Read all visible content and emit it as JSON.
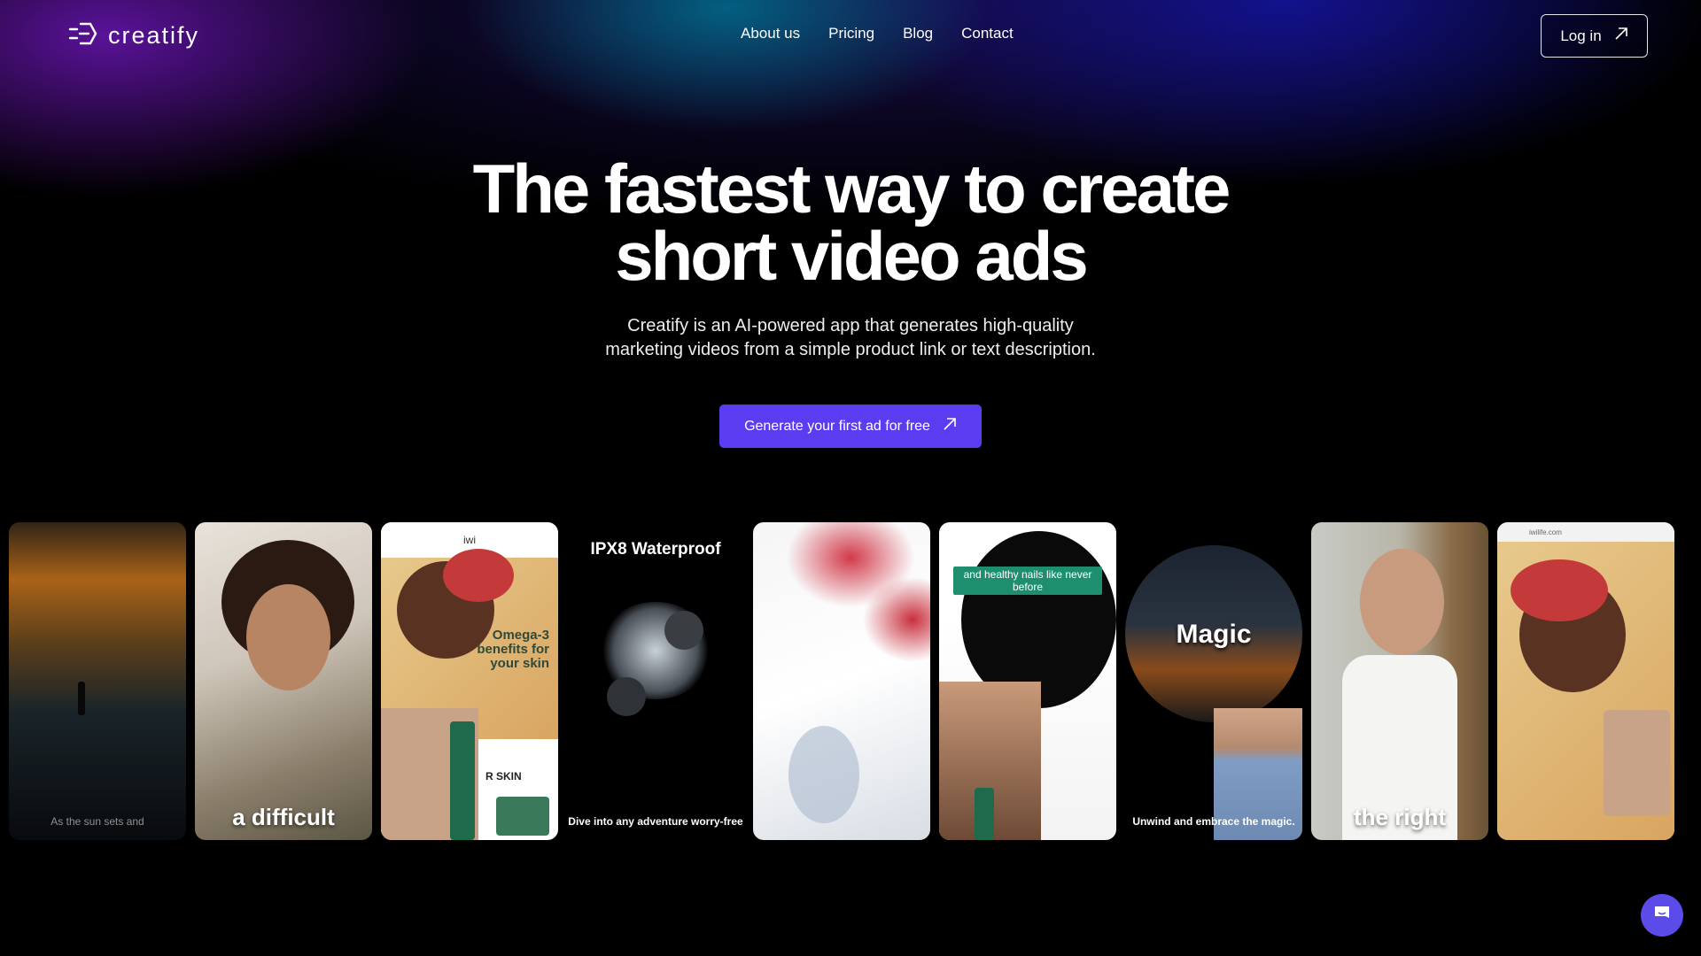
{
  "brand": {
    "name": "creatify"
  },
  "nav": {
    "items": [
      "About us",
      "Pricing",
      "Blog",
      "Contact"
    ],
    "login_label": "Log in"
  },
  "hero": {
    "title_line1": "The fastest way to create",
    "title_line2": "short video ads",
    "subtitle_line1": "Creatify is an AI-powered app that generates high-quality",
    "subtitle_line2": "marketing videos from a simple product link or text description.",
    "cta_label": "Generate your first ad for free"
  },
  "cards": [
    {
      "caption": "As the sun sets and"
    },
    {
      "caption": "a difficult"
    },
    {
      "brand": "iwi",
      "headline": "Omega-3 benefits for your skin",
      "badge": "R SKIN"
    },
    {
      "title": "IPX8 Waterproof",
      "caption": "Dive into any adventure worry-free"
    },
    {
      "caption": ""
    },
    {
      "banner": "and healthy nails like never before"
    },
    {
      "title": "Magic",
      "caption": "Unwind and embrace the magic."
    },
    {
      "caption": "the right"
    },
    {
      "url": "iwilife.com"
    }
  ],
  "colors": {
    "accent": "#5b3cf0",
    "chat_button": "#5b4be8",
    "banner_green": "#1e8f6e"
  },
  "icons": {
    "logo": "creatify-logo-icon",
    "login": "arrow-up-right-icon",
    "cta": "arrow-up-right-icon",
    "chat": "chat-bubble-icon"
  }
}
